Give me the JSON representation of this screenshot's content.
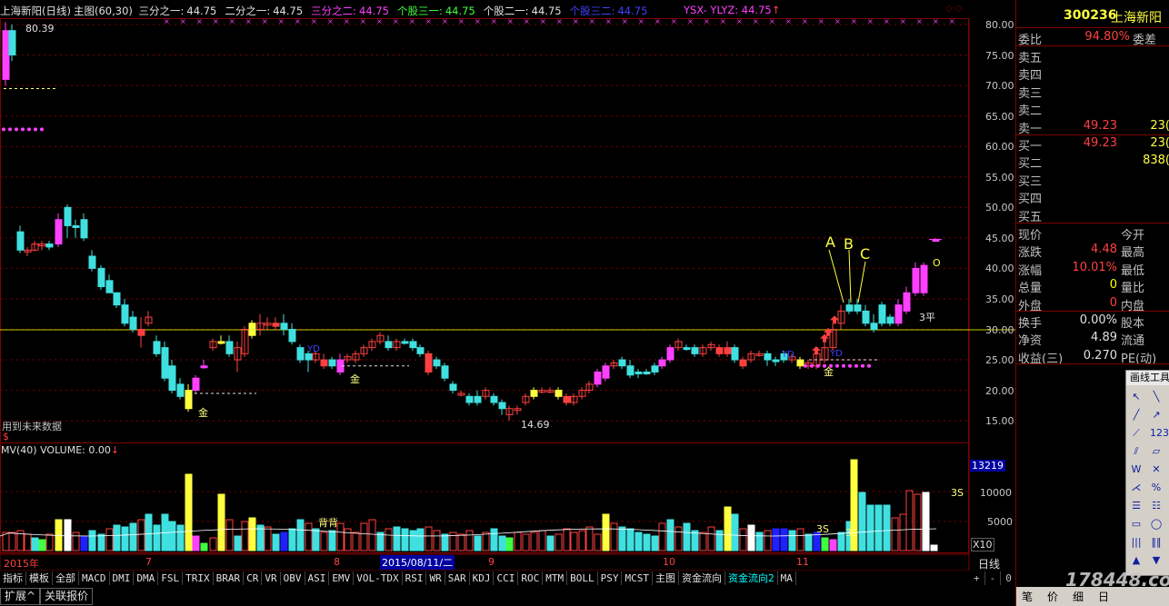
{
  "header": {
    "title": "上海新阳(日线)",
    "main_label": "主图(60,30)",
    "items": [
      {
        "label": "三分之一:",
        "value": "44.75",
        "color": "#e0e0e0"
      },
      {
        "label": "二分之一:",
        "value": "44.75",
        "color": "#e0e0e0"
      },
      {
        "label": "三分之二:",
        "value": "44.75",
        "color": "#ff40ff"
      },
      {
        "label": "个股三一:",
        "value": "44.75",
        "color": "#40ff40"
      },
      {
        "label": "个股二一:",
        "value": "44.75",
        "color": "#e0e0e0"
      },
      {
        "label": "个股三二:",
        "value": "44.75",
        "color": "#4040ff"
      }
    ],
    "ysx_label": "YSX- YLYZ:",
    "ysx_value": "44.75",
    "ysx_arrow": "↑"
  },
  "price_axis": {
    "ticks": [
      "80.00",
      "75.00",
      "70.00",
      "65.00",
      "60.00",
      "55.00",
      "50.00",
      "45.00",
      "40.00",
      "35.00",
      "30.00",
      "25.00",
      "20.00",
      "15.00"
    ]
  },
  "volume_axis": {
    "ticks": [
      "10000",
      "5000"
    ],
    "current": "13219",
    "unit": "X10"
  },
  "annotations": {
    "high": "80.39",
    "low": "14.69",
    "jin1": "金",
    "jin2": "金",
    "jin3": "金",
    "yd1": "YD",
    "yd2": "YD",
    "yd3": "YD",
    "a": "A",
    "b": "B",
    "c": "C",
    "o": "O",
    "ping": "3平",
    "future_note": "用到未来数据",
    "dollar": "$",
    "vol_beibei": "背背",
    "vol_3s_1": "3S",
    "vol_3s_2": "3S",
    "vol_3s_3": "3S"
  },
  "volume_header": {
    "label": "MV(40) VOLUME: 0.00",
    "arrow": "↓"
  },
  "x_axis": {
    "labels": [
      "2015年",
      "7",
      "8",
      "2015/08/11/二",
      "9",
      "10",
      "11"
    ],
    "period": "日线"
  },
  "bottom_tabs": [
    "指标",
    "模板",
    "全部",
    "MACD",
    "DMI",
    "DMA",
    "FSL",
    "TRIX",
    "BRAR",
    "CR",
    "VR",
    "OBV",
    "ASI",
    "EMV",
    "VOL-TDX",
    "RSI",
    "WR",
    "SAR",
    "KDJ",
    "CCI",
    "ROC",
    "MTM",
    "BOLL",
    "PSY",
    "MCST",
    "主图",
    "资金流向",
    "资金流向2",
    "MA"
  ],
  "active_tab": "资金流向2",
  "tab_controls": [
    "+",
    "-",
    "0"
  ],
  "status_row": [
    "扩展^",
    "关联报价"
  ],
  "right_panel": {
    "code": "300236",
    "name": "上海新阳",
    "weibi_label": "委比",
    "weibi_value": "94.80%",
    "weicha_label": "委差",
    "sell": [
      {
        "label": "卖五",
        "price": "",
        "vol": ""
      },
      {
        "label": "卖四",
        "price": "",
        "vol": ""
      },
      {
        "label": "卖三",
        "price": "",
        "vol": ""
      },
      {
        "label": "卖二",
        "price": "",
        "vol": ""
      },
      {
        "label": "卖一",
        "price": "49.23",
        "vol": "23("
      }
    ],
    "buy": [
      {
        "label": "买一",
        "price": "49.23",
        "vol": "23("
      },
      {
        "label": "买二",
        "price": "",
        "vol": "838("
      },
      {
        "label": "买三",
        "price": "",
        "vol": ""
      },
      {
        "label": "买四",
        "price": "",
        "vol": ""
      },
      {
        "label": "买五",
        "price": "",
        "vol": ""
      }
    ],
    "stats": [
      {
        "l1": "现价",
        "v1": "",
        "c1": "#c0c0c0",
        "l2": "今开"
      },
      {
        "l1": "涨跌",
        "v1": "4.48",
        "c1": "#ff4040",
        "l2": "最高"
      },
      {
        "l1": "涨幅",
        "v1": "10.01%",
        "c1": "#ff4040",
        "l2": "最低"
      },
      {
        "l1": "总量",
        "v1": "0",
        "c1": "#ffff00",
        "l2": "量比"
      },
      {
        "l1": "外盘",
        "v1": "0",
        "c1": "#ff4040",
        "l2": "内盘"
      }
    ],
    "stats2": [
      {
        "l1": "换手",
        "v1": "0.00%",
        "l2": "股本"
      },
      {
        "l1": "净资",
        "v1": "4.89",
        "l2": "流通"
      },
      {
        "l1": "收益(三)",
        "v1": "0.270",
        "l2": "PE(动)"
      }
    ],
    "bottom_tabs": [
      "笔",
      "价",
      "细",
      "日"
    ]
  },
  "tool_panel": {
    "title": "画线工具"
  },
  "watermark": "178448.com"
}
